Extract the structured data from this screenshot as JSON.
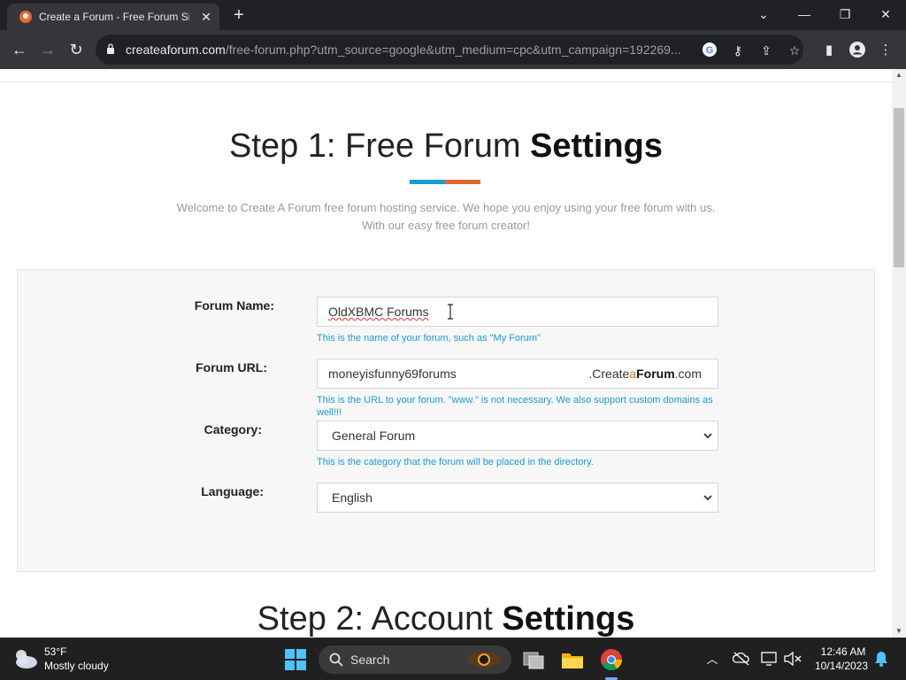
{
  "browser": {
    "tab_title": "Create a Forum - Free Forum Sig",
    "url_host": "createaforum.com",
    "url_path": "/free-forum.php?utm_source=google&utm_medium=cpc&utm_campaign=192269..."
  },
  "page": {
    "step1": {
      "title_light": "Step 1: Free Forum ",
      "title_bold": "Settings"
    },
    "intro_line1": "Welcome to Create A Forum free forum hosting service. We hope you enjoy using your free forum with us.",
    "intro_line2": "With our easy free forum creator!",
    "form": {
      "forum_name": {
        "label": "Forum Name:",
        "value": "OldXBMC Forums",
        "help": "This is the name of your forum, such as \"My Forum\""
      },
      "forum_url": {
        "label": "Forum URL:",
        "value": "moneyisfunny69forums",
        "suffix_pre": ".Create",
        "suffix_a": "a",
        "suffix_bold": "Forum",
        "suffix_post": ".com",
        "help": "This is the URL to your forum. \"www.\" is not necessary. We also support custom domains as well!!!"
      },
      "category": {
        "label": "Category:",
        "value": "General Forum",
        "help": "This is the category that the forum will be placed in the directory."
      },
      "language": {
        "label": "Language:",
        "value": "English"
      }
    },
    "step2": {
      "title_light": "Step 2: Account ",
      "title_bold": "Settings"
    }
  },
  "taskbar": {
    "weather_temp": "53°F",
    "weather_cond": "Mostly cloudy",
    "search_label": "Search",
    "time": "12:46 AM",
    "date": "10/14/2023"
  },
  "colors": {
    "accent_blue": "#1a9bd7",
    "accent_orange": "#e06a2c",
    "chrome_dark": "#202124",
    "chrome_toolbar": "#35363a"
  }
}
